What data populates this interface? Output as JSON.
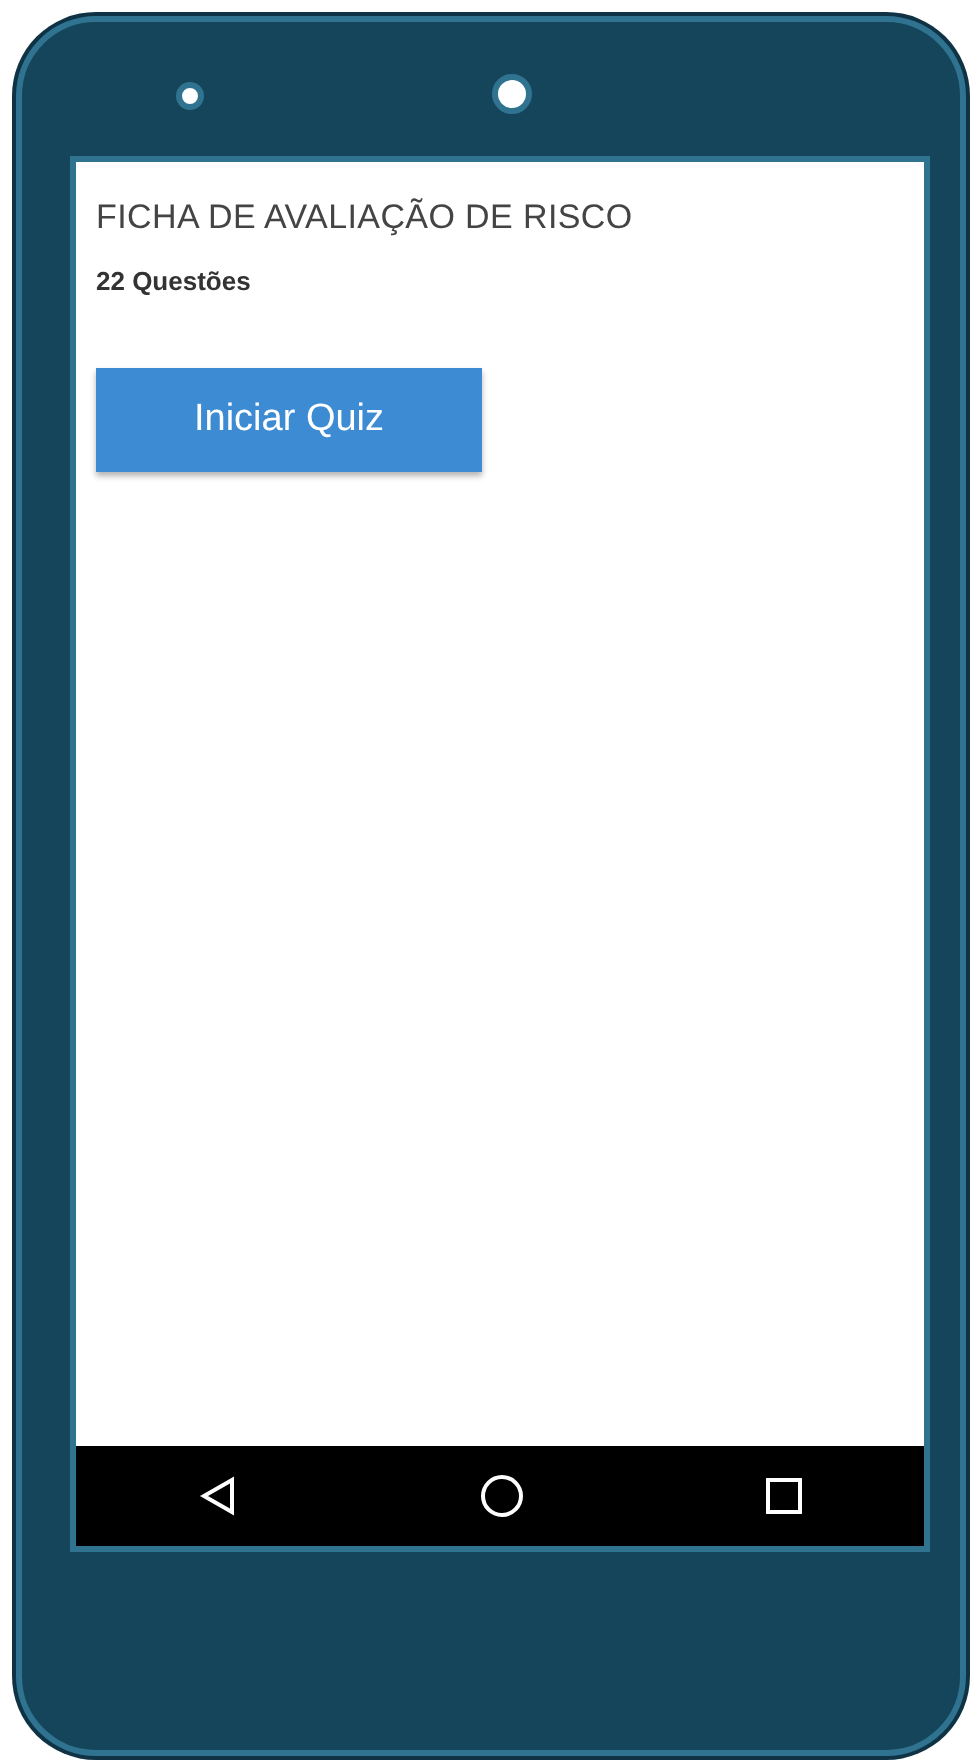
{
  "screen": {
    "title": "FICHA DE AVALIAÇÃO DE RISCO",
    "subtitle": "22 Questões",
    "start_button": "Iniciar Quiz"
  }
}
